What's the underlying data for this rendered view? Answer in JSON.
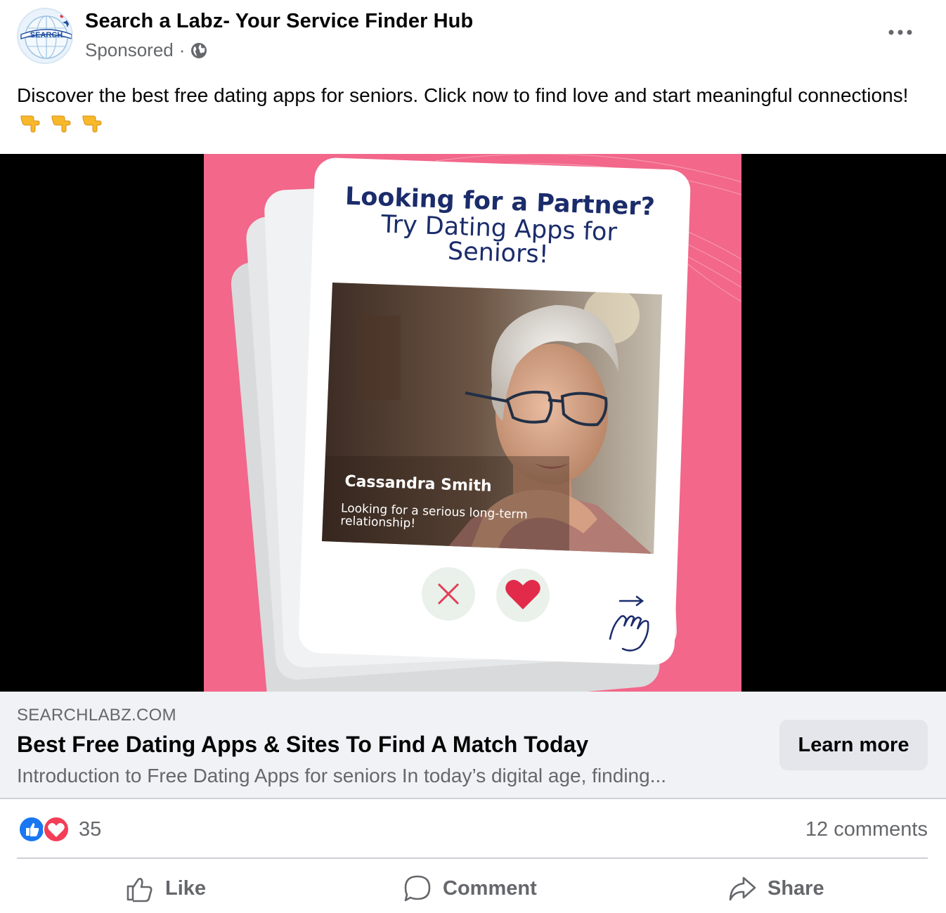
{
  "post": {
    "page_name": "Search a Labz- Your Service Finder Hub",
    "sponsored_label": "Sponsored",
    "separator": "·",
    "caption": "Discover the best free dating apps for seniors. Click now to find love and start meaningful connections!",
    "caption_emoji_icons": [
      "backhand-index-pointing-down",
      "backhand-index-pointing-down",
      "backhand-index-pointing-down"
    ],
    "avatar_logo_text": "SEARCH"
  },
  "creative": {
    "headline_bold": "Looking for a Partner?",
    "headline_regular": "Try Dating Apps for Seniors!",
    "profile_name": "Cassandra Smith",
    "profile_tagline_line1": "Looking for a serious long-term",
    "profile_tagline_line2": "relationship!",
    "background_color": "#f2678a",
    "dismiss_icon": "x-icon",
    "like_icon": "heart-icon",
    "gesture_icon": "swipe-hand-icon"
  },
  "link": {
    "domain": "SEARCHLABZ.COM",
    "title": "Best Free Dating Apps & Sites To Find A Match Today",
    "description": "Introduction to Free Dating Apps for seniors In today’s digital age, finding...",
    "cta_label": "Learn more"
  },
  "engagement": {
    "reaction_count": "35",
    "comments": "12 comments",
    "reaction_icons": [
      "like-reaction",
      "love-reaction"
    ]
  },
  "actions": {
    "like": "Like",
    "comment": "Comment",
    "share": "Share"
  }
}
